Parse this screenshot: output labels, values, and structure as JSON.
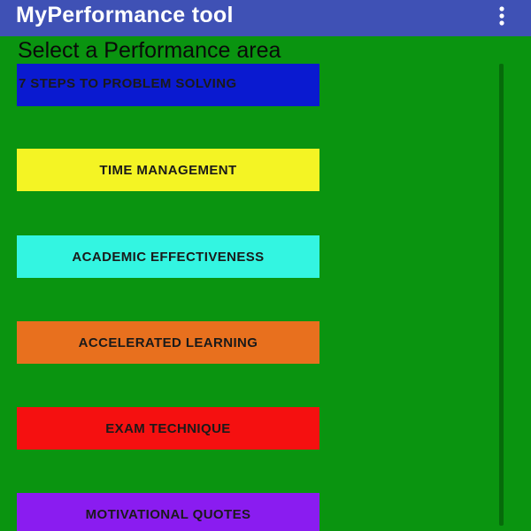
{
  "app_bar": {
    "title": "MyPerformance tool",
    "menu_icon": "more-vertical-icon",
    "background": "#3f51b5"
  },
  "heading": "Select a Performance area",
  "background": "#0a9410",
  "areas": [
    {
      "label": "7 STEPS TO PROBLEM SOLVING",
      "color": "#0a1ad0"
    },
    {
      "label": "TIME MANAGEMENT",
      "color": "#f4f424"
    },
    {
      "label": "ACADEMIC EFFECTIVENESS",
      "color": "#33f5e1"
    },
    {
      "label": "ACCELERATED LEARNING",
      "color": "#e8701e"
    },
    {
      "label": "EXAM TECHNIQUE",
      "color": "#f51010"
    },
    {
      "label": "MOTIVATIONAL QUOTES",
      "color": "#8a1cf0"
    }
  ]
}
